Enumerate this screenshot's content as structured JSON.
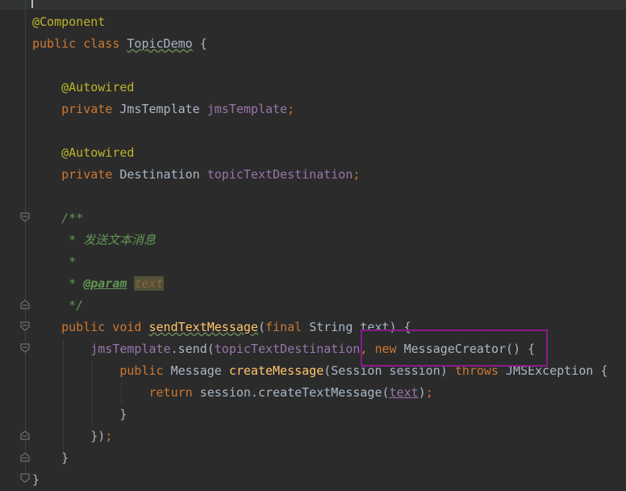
{
  "editor": {
    "lines": {
      "l1": {
        "annotation": "@Component"
      },
      "l2": {
        "kw1": "public",
        "kw2": "class",
        "classname": "TopicDemo",
        "brace": "{"
      },
      "l4": {
        "annotation": "@Autowired"
      },
      "l5": {
        "kw": "private",
        "type": "JmsTemplate",
        "field": "jmsTemplate",
        "semi": ";"
      },
      "l7": {
        "annotation": "@Autowired"
      },
      "l8": {
        "kw": "private",
        "type": "Destination",
        "field": "topicTextDestination",
        "semi": ";"
      },
      "l10": {
        "doc": "/**"
      },
      "l11": {
        "doc": " * 发送文本消息"
      },
      "l12": {
        "doc": " *"
      },
      "l13": {
        "doc": " * ",
        "tag": "@param",
        "param": "text"
      },
      "l14": {
        "doc": " */"
      },
      "l15": {
        "kw1": "public",
        "kw2": "void",
        "method": "sendTextMessage",
        "open": "(",
        "kw3": "final",
        "type": "String",
        "param": "text",
        "close": ") {"
      },
      "l16": {
        "field": "jmsTemplate",
        "call": ".send(",
        "arg": "topicTextDestination",
        "comma": ",",
        "kw": "new",
        "type": "MessageCreator",
        "rest": "() {"
      },
      "l17": {
        "kw": "public",
        "type": "Message",
        "method": "createMessage",
        "open": "(",
        "ptype": "Session",
        "pname": "session",
        "close": ")",
        "kw2": "throws",
        "exc": "JMSException",
        "brace": "{"
      },
      "l18": {
        "kw": "return",
        "call": "session.createTextMessage(",
        "arg": "text",
        "close": ")",
        "semi": ";"
      },
      "l19": {
        "brace": "}"
      },
      "l20": {
        "close": "})",
        "semi": ";"
      },
      "l21": {
        "brace": "}"
      },
      "l22": {
        "brace": "}"
      }
    }
  },
  "colors": {
    "background": "#2b2b2b",
    "keyword": "#cc7832",
    "annotation": "#bbb529",
    "field": "#9876aa",
    "method": "#ffc66d",
    "doc_comment": "#629755",
    "highlight_box": "#8b1a8b"
  }
}
